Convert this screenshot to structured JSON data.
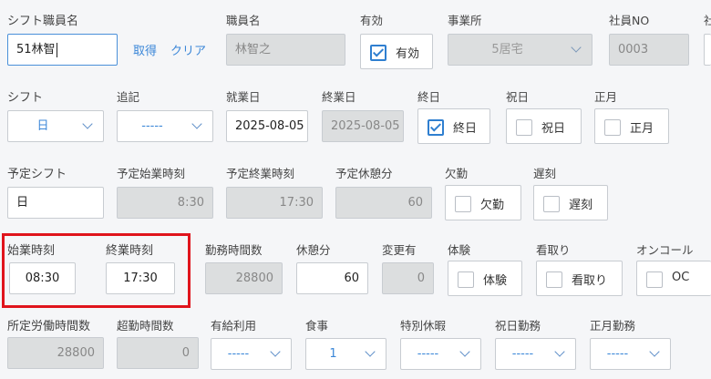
{
  "row1": {
    "shift_staff_name": {
      "label": "シフト職員名",
      "value": "51林智"
    },
    "search_link": "取得",
    "clear_link": "クリア",
    "staff_name": {
      "label": "職員名",
      "value": "林智之"
    },
    "valid": {
      "label": "有効",
      "checkbox_label": "有効",
      "checked": true
    },
    "office": {
      "label": "事業所",
      "value": "5居宅"
    },
    "employee_no": {
      "label": "社員NO",
      "value": "0003"
    },
    "extra": {
      "label": "社"
    }
  },
  "row2": {
    "shift": {
      "label": "シフト",
      "value": "日"
    },
    "note": {
      "label": "追記",
      "value": "-----"
    },
    "work_start_date": {
      "label": "就業日",
      "value": "2025-08-05"
    },
    "work_end_date": {
      "label": "終業日",
      "value": "2025-08-05"
    },
    "all_day": {
      "label": "終日",
      "checkbox_label": "終日",
      "checked": true
    },
    "holiday": {
      "label": "祝日",
      "checkbox_label": "祝日",
      "checked": false
    },
    "new_year": {
      "label": "正月",
      "checkbox_label": "正月",
      "checked": false
    }
  },
  "row3": {
    "planned_shift": {
      "label": "予定シフト",
      "value": "日"
    },
    "planned_start": {
      "label": "予定始業時刻",
      "value": "8:30"
    },
    "planned_end": {
      "label": "予定終業時刻",
      "value": "17:30"
    },
    "planned_break": {
      "label": "予定休憩分",
      "value": "60"
    },
    "absence": {
      "label": "欠勤",
      "checkbox_label": "欠勤",
      "checked": false
    },
    "late": {
      "label": "遅刻",
      "checkbox_label": "遅刻",
      "checked": false
    }
  },
  "row4": {
    "start_time": {
      "label": "始業時刻",
      "value": "08:30"
    },
    "end_time": {
      "label": "終業時刻",
      "value": "17:30"
    },
    "work_seconds": {
      "label": "勤務時間数",
      "value": "28800"
    },
    "break_minutes": {
      "label": "休憩分",
      "value": "60"
    },
    "change": {
      "label": "変更有",
      "value": "0"
    },
    "trial": {
      "label": "体験",
      "checkbox_label": "体験",
      "checked": false
    },
    "end_of_life": {
      "label": "看取り",
      "checkbox_label": "看取り",
      "checked": false
    },
    "on_call": {
      "label": "オンコール",
      "checkbox_label": "OC",
      "checked": false
    }
  },
  "row5": {
    "scheduled_labor": {
      "label": "所定労働時間数",
      "value": "28800"
    },
    "overtime": {
      "label": "超勤時間数",
      "value": "0"
    },
    "paid_leave": {
      "label": "有給利用",
      "value": "-----"
    },
    "meal": {
      "label": "食事",
      "value": "1"
    },
    "special_leave": {
      "label": "特別休暇",
      "value": "-----"
    },
    "holiday_work": {
      "label": "祝日勤務",
      "value": "-----"
    },
    "new_year_work": {
      "label": "正月勤務",
      "value": "-----"
    }
  },
  "colors": {
    "accent": "#3b87d8",
    "highlight": "#e0141c",
    "readonly": "#dcdedf"
  }
}
